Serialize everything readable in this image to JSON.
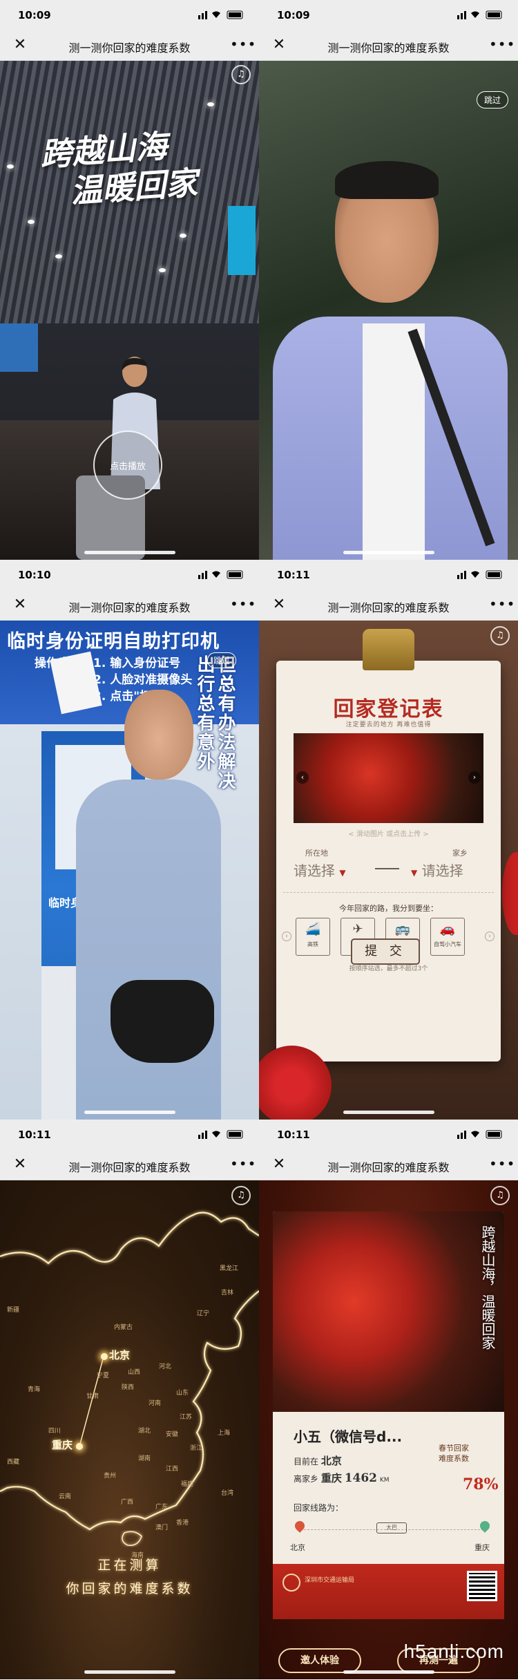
{
  "nav": {
    "close_icon": "close-icon",
    "title": "测一测你回家的难度系数",
    "more_icon": "more-dots-icon"
  },
  "panels": [
    {
      "time": "10:09",
      "headline_1": "跨越山海",
      "headline_2": "温暖回家",
      "play_label": "点击播放"
    },
    {
      "time": "10:09",
      "skip_label": "跳过"
    },
    {
      "time": "10:10",
      "banner_title": "临时身份证明自助打印机",
      "steps_label": "操作步骤：",
      "step_1": "1. 输入身份证号",
      "step_2": "2. 人脸对准摄像头",
      "step_3": "3. 点击\"打印\"",
      "skip_label": "跳过",
      "slogan_1": "出行总有意外",
      "slogan_2": "但总有办法解决",
      "kiosk_label": "临时身份证件"
    },
    {
      "time": "10:11",
      "form_title": "回家登记表",
      "form_subtitle": "注定要去的地方  再难也值得",
      "upload_hint": "< 滑动图片 或点击上传 >",
      "from_label": "所在地",
      "to_label": "家乡",
      "from_select": "请选择",
      "to_select": "请选择",
      "question": "今年回家的路，我分到要坐：",
      "modes": [
        "高铁",
        "飞机",
        "大巴",
        "自驾小汽车"
      ],
      "mode_note": "按顺序站选，最多不超过3个",
      "submit_label": "提 交"
    },
    {
      "time": "10:11",
      "calc_1": "正在测算",
      "calc_2": "你回家的难度系数",
      "city_from": "北京",
      "city_to": "重庆",
      "provinces": [
        "黑龙江",
        "吉林",
        "辽宁",
        "内蒙古",
        "宁夏",
        "山西",
        "河北",
        "陕西",
        "甘肃",
        "青海",
        "河南",
        "山东",
        "江苏",
        "四川",
        "湖北",
        "安徽",
        "上海",
        "浙江",
        "湖南",
        "江西",
        "贵州",
        "福建",
        "云南",
        "广西",
        "广东",
        "台湾",
        "香港",
        "澳门",
        "海南",
        "西藏",
        "新疆"
      ]
    },
    {
      "time": "10:11",
      "poster_title": "跨越山海，温暖回家",
      "user_name": "小五（微信号d...",
      "current_label": "目前在",
      "current_city": "北京",
      "distance_label": "离家乡",
      "home_city": "重庆",
      "distance": "1462",
      "distance_unit": "KM",
      "coef_label_1": "春节回家",
      "coef_label_2": "难度系数",
      "coef_value": "78%",
      "route_label": "回家线路为：",
      "route_from": "北京",
      "route_to": "重庆",
      "route_mode": "大巴",
      "sponsor": "深圳市交通运输局",
      "btn_invite": "邀人体验",
      "btn_retry": "再测一遍"
    }
  ],
  "watermark": "h5anli.com",
  "colors": {
    "nav_bg": "#ededed",
    "accent_red": "#b52a20",
    "gold": "#f3d9a8"
  }
}
